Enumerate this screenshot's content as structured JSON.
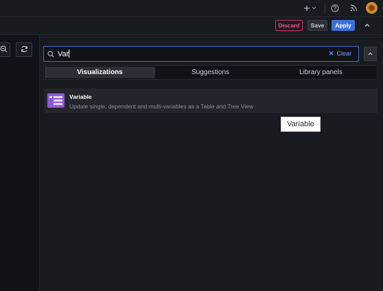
{
  "topbar": {
    "icons": [
      "plus-icon",
      "chevron-down-icon",
      "help-icon",
      "rss-icon",
      "avatar"
    ]
  },
  "toolbar": {
    "discard_label": "Discard",
    "save_label": "Save",
    "apply_label": "Apply"
  },
  "left_pane": {
    "buttons": [
      "zoom-out-icon",
      "refresh-icon"
    ]
  },
  "search": {
    "value": "Var",
    "clear_label": "Clear"
  },
  "tabs": [
    {
      "label": "Visualizations",
      "active": true
    },
    {
      "label": "Suggestions",
      "active": false
    },
    {
      "label": "Library panels",
      "active": false
    }
  ],
  "results": [
    {
      "title": "Variable",
      "description": "Update single, dependent and multi-variables as a Table and Tree View"
    }
  ],
  "tooltip": {
    "text": "Variable"
  },
  "colors": {
    "accent": "#3d71d9",
    "discard": "#e0226e",
    "plugin_icon": "#8b5cd6"
  }
}
